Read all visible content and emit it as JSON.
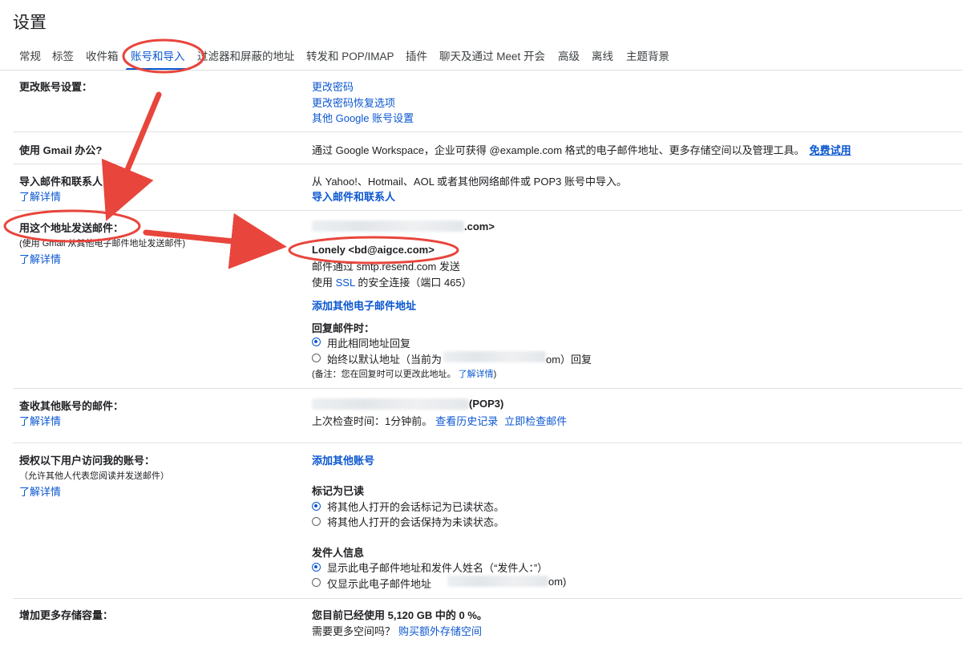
{
  "page_title": "设置",
  "tabs": [
    {
      "label": "常规",
      "active": false
    },
    {
      "label": "标签",
      "active": false
    },
    {
      "label": "收件箱",
      "active": false
    },
    {
      "label": "账号和导入",
      "active": true
    },
    {
      "label": "过滤器和屏蔽的地址",
      "active": false
    },
    {
      "label": "转发和 POP/IMAP",
      "active": false
    },
    {
      "label": "插件",
      "active": false
    },
    {
      "label": "聊天及通过 Meet 开会",
      "active": false
    },
    {
      "label": "高级",
      "active": false
    },
    {
      "label": "离线",
      "active": false
    },
    {
      "label": "主题背景",
      "active": false
    }
  ],
  "colors": {
    "accent": "#0b57d0",
    "annotation": "#e8453c"
  },
  "sections": {
    "change_account": {
      "label": "更改账号设置：",
      "links": [
        "更改密码",
        "更改密码恢复选项",
        "其他 Google 账号设置"
      ]
    },
    "workspace": {
      "label": "使用 Gmail 办公?",
      "text": "通过 Google Workspace，企业可获得 @example.com 格式的电子邮件地址、更多存储空间以及管理工具。",
      "link": "免费试用"
    },
    "import": {
      "label": "导入邮件和联系人：",
      "learn_more": "了解详情",
      "text": "从 Yahoo!、Hotmail、AOL 或者其他网络邮件或 POP3 账号中导入。",
      "link": "导入邮件和联系人"
    },
    "send_as": {
      "label": "用这个地址发送邮件：",
      "sublabel": "(使用 Gmail 从其他电子邮件地址发送邮件)",
      "learn_more": "了解详情",
      "address1_suffix": ".com>",
      "address2": "Lonely <bd@aigce.com>",
      "smtp_text": "邮件通过 smtp.resend.com 发送",
      "ssl_prefix": "使用 ",
      "ssl_link": "SSL",
      "ssl_suffix": " 的安全连接（端口 465）",
      "add_link": "添加其他电子邮件地址",
      "reply_heading": "回复邮件时：",
      "reply_opt1": "用此相同地址回复",
      "reply_opt2_prefix": "始终以默认地址（当前为",
      "reply_opt2_suffix": "om）回复",
      "note_prefix": "(备注：您在回复时可以更改此地址。",
      "note_link": "了解详情",
      "note_suffix": ")"
    },
    "check_mail": {
      "label": "查收其他账号的邮件：",
      "learn_more": "了解详情",
      "account_suffix": "(POP3)",
      "last_check": "上次检查时间：1分钟前。",
      "history_link": "查看历史记录",
      "check_now_link": "立即检查邮件"
    },
    "grant_access": {
      "label": "授权以下用户访问我的账号：",
      "sublabel": "（允许其他人代表您阅读并发送邮件）",
      "learn_more": "了解详情",
      "add_link": "添加其他账号",
      "mark_read_heading": "标记为已读",
      "mark_opt1": "将其他人打开的会话标记为已读状态。",
      "mark_opt2": "将其他人打开的会话保持为未读状态。",
      "sender_heading": "发件人信息",
      "sender_opt1": "显示此电子邮件地址和发件人姓名（“发件人：”）",
      "sender_opt2_prefix": "仅显示此电子邮件地址",
      "sender_opt2_suffix": "om)"
    },
    "storage": {
      "label": "增加更多存储容量：",
      "usage": "您目前已经使用 5,120 GB 中的 0 %。",
      "more_space": "需要更多空间吗？",
      "buy_link": "购买额外存储空间"
    }
  }
}
